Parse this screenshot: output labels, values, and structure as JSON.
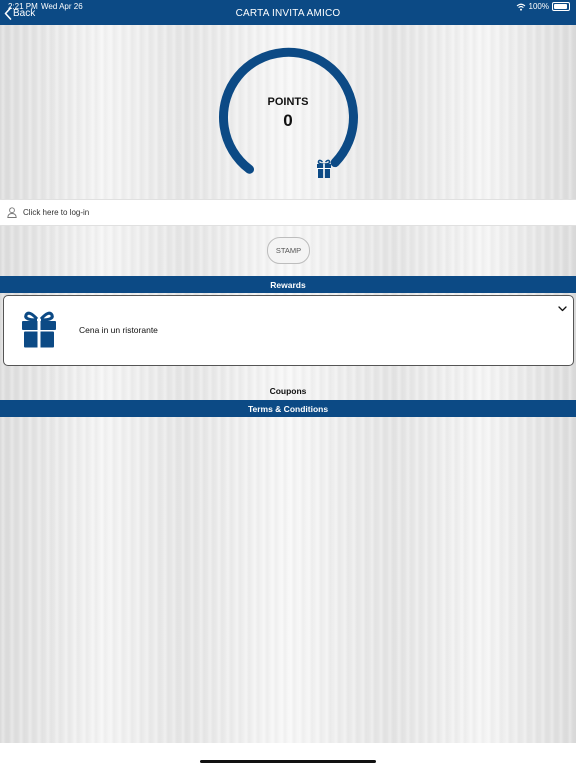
{
  "status_bar": {
    "time": "2:21 PM",
    "date": "Wed Apr 26",
    "battery": "100%"
  },
  "nav": {
    "back_label": "Back",
    "title": "CARTA INVITA AMICO"
  },
  "points": {
    "label": "POINTS",
    "value": "0"
  },
  "login": {
    "label": "Click here to log-in"
  },
  "stamp": {
    "label": "STAMP"
  },
  "rewards": {
    "header": "Rewards",
    "items": [
      {
        "name": "Cena in un ristorante"
      }
    ]
  },
  "coupons": {
    "header": "Coupons"
  },
  "terms": {
    "header": "Terms & Conditions"
  },
  "colors": {
    "brand_blue": "#0c4a85",
    "white": "#ffffff"
  },
  "icons": [
    "back-chevron-icon",
    "wifi-icon",
    "battery-icon",
    "gift-icon",
    "user-icon",
    "chevron-down-icon"
  ]
}
